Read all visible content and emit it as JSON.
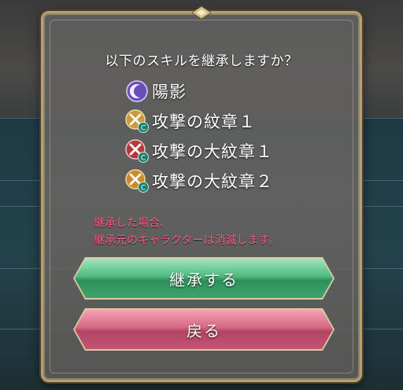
{
  "dialog": {
    "question": "以下のスキルを継承しますか？",
    "skills": [
      {
        "name": "陽影",
        "icon": "shadow-moon-icon"
      },
      {
        "name": "攻撃の紋章１",
        "icon": "attack-crest-icon"
      },
      {
        "name": "攻撃の大紋章１",
        "icon": "attack-grand-crest-icon"
      },
      {
        "name": "攻撃の大紋章２",
        "icon": "attack-grand-crest-icon"
      }
    ],
    "warning_line1": "継承した場合、",
    "warning_line2": "継承元のキャラクターは消滅します。",
    "confirm_label": "継承する",
    "back_label": "戻る"
  },
  "colors": {
    "confirm": "#4fba7f",
    "back": "#d56782",
    "warning": "#ff5a86"
  }
}
